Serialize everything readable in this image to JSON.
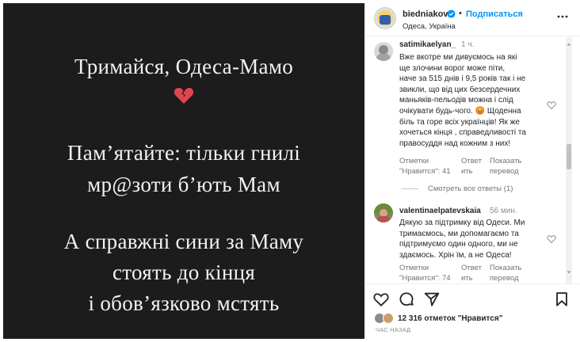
{
  "post": {
    "lines": [
      "Тримайся, Одеса-Мамо",
      "Пам’ятайте: тільки гнилі",
      "мр@зоти б’ють Мам",
      "А справжні сини за Маму",
      "стоять до кінця",
      "і обов’язково мстять"
    ],
    "heart_emoji": "broken-heart-icon"
  },
  "header": {
    "username": "biedniakov",
    "separator": "•",
    "follow_label": "Подписаться",
    "location": "Одеса, Україна"
  },
  "comments": [
    {
      "username": "satimikaelyan_",
      "time": "1 ч.",
      "lines": [
        "Вже вкотре ми дивуємось на які",
        "ще злочини ворог може піти,",
        "наче за 515 днів і 9,5 років так і не",
        "звикли, що від цих безсердечних",
        "маньяків-пельодів можна і слід",
        "очікувати будь-чого. 😡 Щоденна",
        "біль та горе всіх українців! Як же",
        "хочеться кінця , справедливості та",
        "правосуддя над кожним з них!"
      ],
      "likes_label_1": "Отметки",
      "likes_label_2": "\"Нравится\": 41",
      "reply_1": "Ответ",
      "reply_2": "ить",
      "translate_1": "Показать",
      "translate_2": "перевод",
      "view_replies": "Смотреть все ответы (1)"
    },
    {
      "username": "valentinaelpatevskaia",
      "time": "56 мин.",
      "lines": [
        "Дякую за підтримку від Одеси. Ми",
        "тримаємось, ми допомагаємо та",
        "підтримуємо один одного, ми не",
        "здаємось. Хрін їм, а не Одеса!"
      ],
      "likes_label_1": "Отметки",
      "likes_label_2": "\"Нравится\": 74",
      "reply_1": "Ответ",
      "reply_2": "ить",
      "translate_1": "Показать",
      "translate_2": "перевод"
    }
  ],
  "footer": {
    "likes_text": "12 316 отметок \"Нравится\"",
    "time_ago": "ЧАС НАЗАД"
  },
  "colors": {
    "post_background": "#1c1c1c",
    "follow_blue": "#0095f6",
    "verified_blue": "#0095f6",
    "broken_heart_red": "#e0464f"
  }
}
